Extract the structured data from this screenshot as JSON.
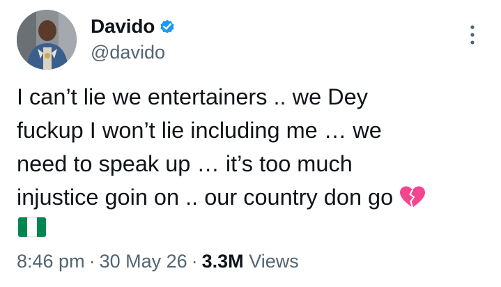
{
  "author": {
    "display_name": "Davido",
    "handle": "@davido",
    "verified": true
  },
  "post": {
    "text_lines": [
      "I can’t lie we entertainers .. we Dey",
      "fuckup I won’t lie including me … we",
      "need to speak up … it’s too much",
      "injustice goin on .. our country don go"
    ],
    "emojis": [
      "broken-heart-icon",
      "nigeria-flag-icon"
    ]
  },
  "meta": {
    "time": "8:46 pm",
    "separator": "·",
    "date": "30 May 26",
    "views_count": "3.3M",
    "views_label": "Views"
  },
  "icons": {
    "verified": "verified-badge-icon",
    "more": "more-options-icon"
  },
  "colors": {
    "text_primary": "#0f1419",
    "text_secondary": "#536471",
    "verified_blue": "#1d9bf0",
    "heart_pink": "#f4468f",
    "flag_green": "#008751"
  }
}
